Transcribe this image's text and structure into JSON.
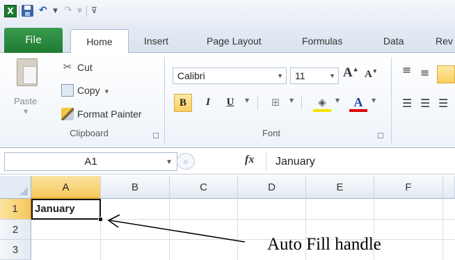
{
  "quick_access": {
    "app_icon": "X",
    "icons": [
      "excel-icon",
      "save-icon",
      "undo-icon",
      "redo-icon",
      "customize-icon"
    ]
  },
  "tabs": [
    {
      "label": "File"
    },
    {
      "label": "Home"
    },
    {
      "label": "Insert"
    },
    {
      "label": "Page Layout"
    },
    {
      "label": "Formulas"
    },
    {
      "label": "Data"
    },
    {
      "label": "Rev"
    }
  ],
  "clipboard": {
    "paste_label": "Paste",
    "cut_label": "Cut",
    "copy_label": "Copy",
    "copy_dropdown": "▾",
    "format_painter_label": "Format Painter",
    "group_label": "Clipboard"
  },
  "font": {
    "font_name": "Calibri",
    "font_size": "11",
    "bold_label": "B",
    "italic_label": "I",
    "underline_label": "U",
    "font_color_label": "A",
    "group_label": "Font"
  },
  "formula_bar": {
    "name_box": "A1",
    "fx_label": "fx",
    "value": "January"
  },
  "grid": {
    "columns": [
      "A",
      "B",
      "C",
      "D",
      "E",
      "F"
    ],
    "rows": [
      "1",
      "2",
      "3"
    ],
    "active_cell_value": "January"
  },
  "annotation": {
    "label": "Auto Fill handle"
  },
  "colors": {
    "file_tab": "#1f7a32",
    "selection_header": "#f6c85c",
    "font_color_bar": "#e00000"
  }
}
